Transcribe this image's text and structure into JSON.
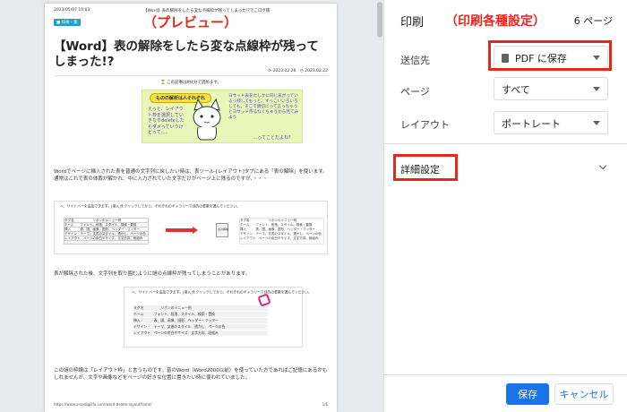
{
  "preview": {
    "annotation": "（プレビュー）",
    "header_date": "2023/05/07 10:03",
    "header_title": "【Word】表の解除をしたら変な点線枠が残ってしまった!?でこログ帳",
    "category": "■ 技術・集",
    "article_title": "【Word】表の解除をしたら変な点線枠が残ってしまった!?",
    "dates": "⟳ 2023.02.26　◷ 2023.02.22",
    "read_time": "⏳ この記事は約4分で読めます。",
    "illustration": {
      "badge": "ものの解析は人それぞれ",
      "left_text": "えっと、レイアウト枠を選択していきなりdeleteしたらダメっていうけどって。。。",
      "right_text": "ヨサッド表をたしかに同じ表がっているっ残してもっと。すっこいいろいろしても。そこで親切にって言っちゃうとヨサッド作るなくちゃうから見てみよう",
      "bottom_text": "…ってことだよね？"
    },
    "para1": "Wordでページに挿入された表を普通の文字列に戻したい時は、表ツール-[レイアウト]タブにある「表の解除」を使います。通常はこれで表の体裁が解かれ、中に入力されていた文字だけがページ上に残るのですが、・・・",
    "figure1_caption": "へ、サイドバーを追加できます。[挿入]をクリックしてから、それぞれのギャラリーで目的の要素を選んでください。",
    "figure1_rows": [
      "タグ名　　　　　　リボンのメニュー例",
      "ホーム　　フォント、段落、スタイル、検索・置換",
      "挿入　　　表、図、画像、図形、ヘッダー・フッター",
      "デザイン　テーマ、文書のスタイル、透かし、ページの色",
      "レイアウト　ページの余白やサイズ、文字方向、段組み"
    ],
    "figure1_doc_label": "表の解除",
    "para2": "表が解除された後、文字列を取り囲むように謎の点線枠が残ってしまうことがあります。",
    "figure2_caption": "へ、サイドバーを追加できます。[挿入]をクリックしてから、それぞれのギャラリーで目的の要素を選んでください。",
    "figure2_rows": [
      "タグ名　　　　　リボンのメニュー例",
      "ホーム　　　フォント、段落、スタイル、検索・置換",
      "挿入　　　　表、図、画像、図形、ヘッダー・フッター",
      "デザイン　　テーマ、文書のスタイル、透かし、ページの色",
      "レイアウト　ページの余白やサイズ、文字方向、段組み"
    ],
    "para3": "この謎の枠線は「レイアウト枠」と言うものです。昔のWord（Word2000以前）を使っていた方であればご記憶にあるかもしれませんが、文字や画像などをページの好きな位置に置きたい時に使われていました。",
    "footer_url": "https://www.aroadigilife.com/word-delete-layoutframe/",
    "footer_page": "1/6"
  },
  "settings": {
    "title": "印刷",
    "annotation": "（印刷各種設定）",
    "page_count": "6 ページ",
    "destination_label": "送信先",
    "destination_value": "PDF に保存",
    "pages_label": "ページ",
    "pages_value": "すべて",
    "layout_label": "レイアウト",
    "layout_value": "ポートレート",
    "more_settings": "詳細設定",
    "save_label": "保存",
    "cancel_label": "キャンセル"
  },
  "colors": {
    "accent": "#1a73e8",
    "annotation_red": "#e8261c",
    "preview_bg": "#e8eaed"
  },
  "icons": [
    "pdf-file-icon",
    "chevron-down-icon",
    "caret-down-icon"
  ]
}
